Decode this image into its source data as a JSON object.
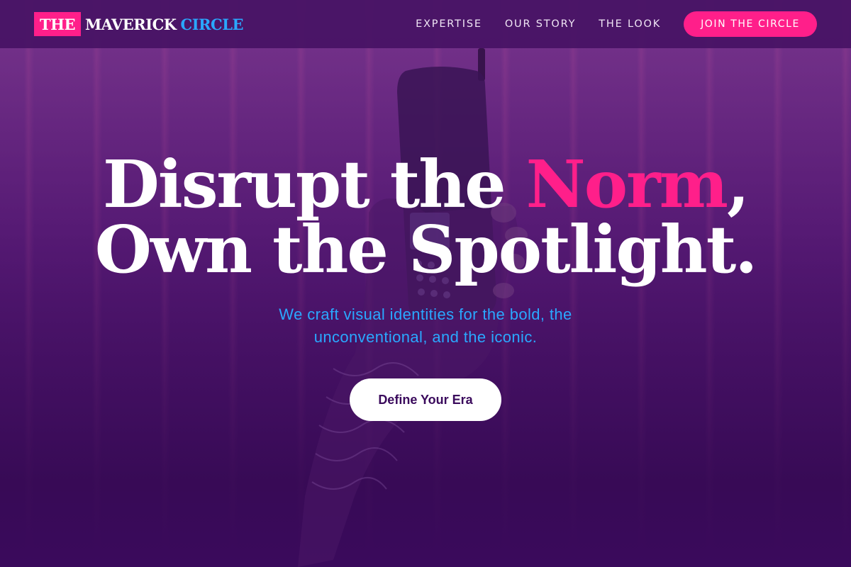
{
  "brand": {
    "part1": "THE",
    "part2": "MAVERICK",
    "part3": "CIRCLE",
    "accent_pink": "#ff1f8a",
    "accent_blue": "#2aa8ff"
  },
  "nav": {
    "links": [
      "EXPERTISE",
      "OUR STORY",
      "THE LOOK"
    ],
    "cta": "JOIN THE CIRCLE"
  },
  "hero": {
    "headline_pre": "Disrupt the ",
    "headline_accent": "Norm",
    "headline_post": ",",
    "headline_line2": "Own the Spotlight.",
    "subhead": "We craft visual identities for the bold, the unconventional, and the iconic.",
    "cta": "Define Your Era",
    "background_image": "retro-mobile-phone-in-hand"
  }
}
